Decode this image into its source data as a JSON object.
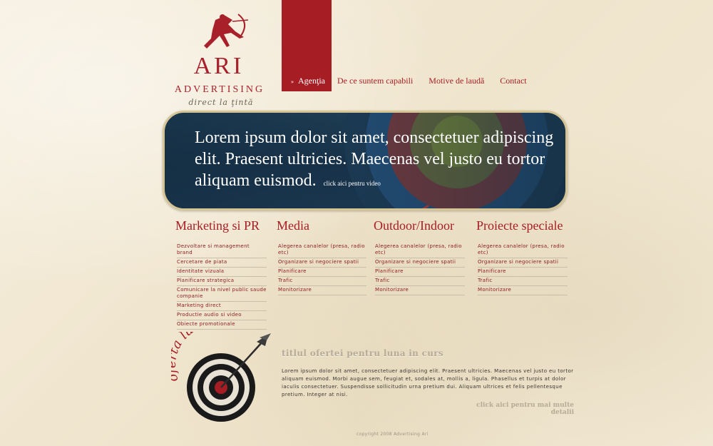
{
  "logo": {
    "mark": "ARI",
    "word": "ADVERTISING",
    "tagline": "direct la ţintă"
  },
  "nav": {
    "bullet": "»",
    "items": [
      {
        "label": "Agenţia",
        "active": true
      },
      {
        "label": "De ce suntem capabili"
      },
      {
        "label": "Motive de laudă"
      },
      {
        "label": "Contact"
      }
    ]
  },
  "hero": {
    "text": "Lorem ipsum dolor sit amet, consectetuer adipiscing elit. Praesent ultricies. Maecenas vel justo eu tortor aliquam euismod.",
    "link": "click aici pentru video"
  },
  "columns": [
    {
      "title": "Marketing si PR",
      "items": [
        "Dezvoltare si management brand",
        "Cercetare de piata",
        "Identitate vizuala",
        "Planificare strategica",
        "Comunicare la nivel public saude companie",
        "Marketing direct",
        "Productie audio si video",
        "Obiecte promotionale"
      ]
    },
    {
      "title": "Media",
      "items": [
        "Alegerea canalelor (presa, radio etc)",
        "Organizare si negociere spatii",
        "Planificare",
        "Trafic",
        "Monitorizare"
      ]
    },
    {
      "title": "Outdoor/Indoor",
      "items": [
        "Alegerea canalelor (presa, radio etc)",
        "Organizare si negociere spatii",
        "Planificare",
        "Trafic",
        "Monitorizare"
      ]
    },
    {
      "title": "Proiecte speciale",
      "items": [
        "Alegerea canalelor (presa, radio etc)",
        "Organizare si negociere spatii",
        "Planificare",
        "Trafic",
        "Monitorizare"
      ]
    }
  ],
  "offer": {
    "badge": "oferta lunii",
    "title": "titlul ofertei pentru luna in curs",
    "body": "Lorem ipsum dolor sit amet, consectetuer adipiscing elit. Praesent ultricies. Maecenas vel justo eu tortor aliquam euismod. Morbi augue sem, feugiat et, sodales at, mollis a, ligula. Phasellus et turpis at dolor iaculis consectetuer. Suspendisse sollicitudin urna pretium dui. Aliquam ultrices et felis pellentesque pretium. Integer at nisi.",
    "more": "click aici pentru mai multe detalii"
  },
  "footer": {
    "copyright": "copyright 2008 Advertising Ari"
  },
  "colors": {
    "brand": "#a71d24",
    "background": "#f3ead6",
    "hero": "#1f3e55",
    "hero_border": "#d6c594"
  }
}
